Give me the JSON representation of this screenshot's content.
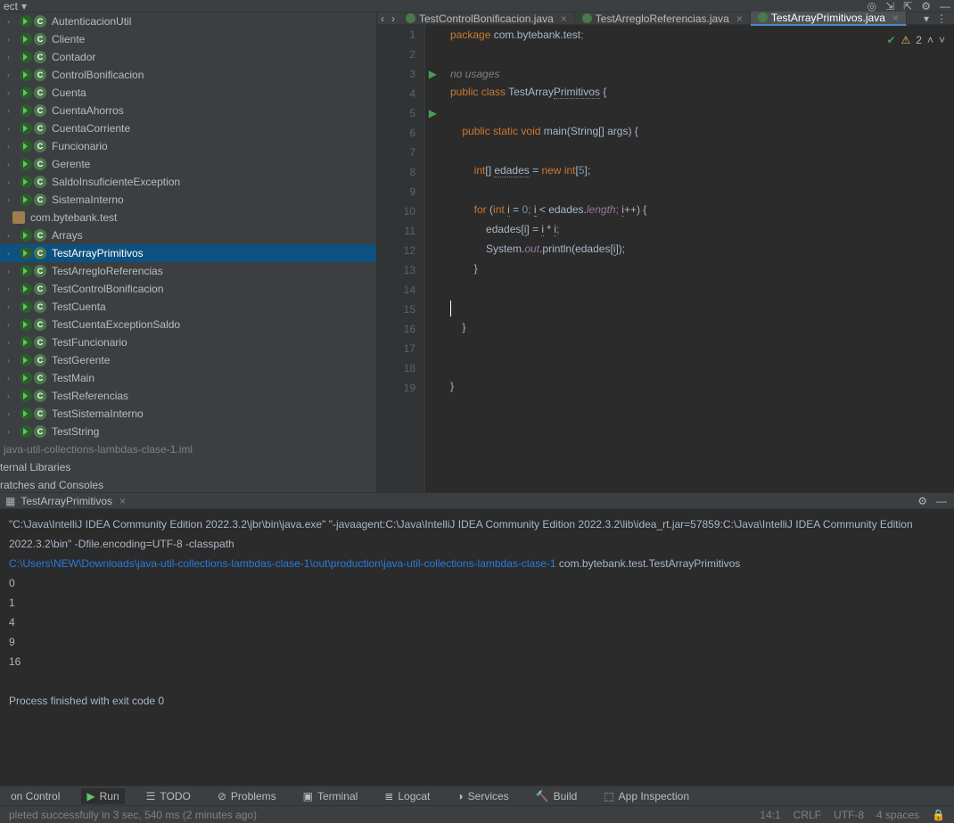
{
  "toolbar": {
    "project_label": "ect"
  },
  "tree": {
    "items": [
      {
        "chevron": true,
        "icons": [
          "run",
          "cls"
        ],
        "label": "AutenticacionUtil"
      },
      {
        "chevron": true,
        "icons": [
          "run",
          "cls"
        ],
        "label": "Cliente"
      },
      {
        "chevron": true,
        "icons": [
          "run",
          "cls"
        ],
        "label": "Contador"
      },
      {
        "chevron": true,
        "icons": [
          "run",
          "cls"
        ],
        "label": "ControlBonificacion"
      },
      {
        "chevron": true,
        "icons": [
          "run",
          "abs"
        ],
        "label": "Cuenta"
      },
      {
        "chevron": true,
        "icons": [
          "run",
          "cls"
        ],
        "label": "CuentaAhorros"
      },
      {
        "chevron": true,
        "icons": [
          "run",
          "cls"
        ],
        "label": "CuentaCorriente"
      },
      {
        "chevron": true,
        "icons": [
          "run",
          "abs"
        ],
        "label": "Funcionario"
      },
      {
        "chevron": true,
        "icons": [
          "run",
          "cls"
        ],
        "label": "Gerente"
      },
      {
        "chevron": true,
        "icons": [
          "run",
          "cls"
        ],
        "label": "SaldoInsuficienteException"
      },
      {
        "chevron": true,
        "icons": [
          "run",
          "cls"
        ],
        "label": "SistemaInterno"
      }
    ],
    "pkg_label": "com.bytebank.test",
    "tests": [
      {
        "label": "Arrays"
      },
      {
        "label": "TestArrayPrimitivos",
        "selected": true
      },
      {
        "label": "TestArregloReferencias"
      },
      {
        "label": "TestControlBonificacion"
      },
      {
        "label": "TestCuenta"
      },
      {
        "label": "TestCuentaExceptionSaldo"
      },
      {
        "label": "TestFuncionario"
      },
      {
        "label": "TestGerente"
      },
      {
        "label": "TestMain"
      },
      {
        "label": "TestReferencias"
      },
      {
        "label": "TestSistemaInterno"
      },
      {
        "label": "TestString"
      }
    ],
    "iml_label": "java-util-collections-lambdas-clase-1.iml",
    "ext_lib_label": "ternal Libraries",
    "scratch_label": "ratches and Consoles"
  },
  "tabs": {
    "t1": "TestControlBonificacion.java",
    "t2": "TestArregloReferencias.java",
    "t3": "TestArrayPrimitivos.java"
  },
  "editor": {
    "no_usages": "no usages",
    "inspections_count": "2",
    "lines": {
      "1": "1",
      "2": "2",
      "3": "3",
      "4": "4",
      "5": "5",
      "6": "6",
      "7": "7",
      "8": "8",
      "9": "9",
      "10": "10",
      "11": "11",
      "12": "12",
      "13": "13",
      "14": "14",
      "15": "15",
      "16": "16",
      "17": "17",
      "18": "18",
      "19": "19"
    },
    "code": {
      "kw_package": "package",
      "pkg_name": "com.bytebank.test",
      "kw_public": "public",
      "kw_class": "class",
      "cls_name": "TestArray",
      "cls_name2": "Primitivos",
      "kw_static": "static",
      "kw_void": "void",
      "main": "main",
      "params": "(String[] args) {",
      "kw_int": "int",
      "arr": "[]",
      "var_edades": "edades",
      "eq": "=",
      "kw_new": "new",
      "five": "5",
      "kw_for": "for",
      "zero": "0",
      "var_i": "i",
      "lt": "<",
      "len": "length",
      "sys": "System",
      "out": "out",
      "println": ".println(edades[",
      "close": "]);"
    }
  },
  "run": {
    "tab_label": "TestArrayPrimitivos",
    "cmd1": "\"C:\\Java\\IntelliJ IDEA Community Edition 2022.3.2\\jbr\\bin\\java.exe\" \"-javaagent:C:\\Java\\IntelliJ IDEA Community Edition 2022.3.2\\lib\\idea_rt.jar=57859:C:\\Java\\IntelliJ IDEA Community Edition 2022.3.2\\bin\" -Dfile.encoding=UTF-8 -classpath ",
    "link": "C:\\Users\\NEW\\Downloads\\java-util-collections-lambdas-clase-1\\out\\production\\java-util-collections-lambdas-clase-1",
    "cmd2": " com.bytebank.test.TestArrayPrimitivos",
    "out0": "0",
    "out1": "1",
    "out2": "4",
    "out3": "9",
    "out4": "16",
    "exit": "Process finished with exit code 0"
  },
  "bottom": {
    "vc": "on Control",
    "run": "Run",
    "todo": "TODO",
    "problems": "Problems",
    "terminal": "Terminal",
    "logcat": "Logcat",
    "services": "Services",
    "build": "Build",
    "appinsp": "App Inspection",
    "status_msg": "pleted successfully in 3 sec, 540 ms (2 minutes ago)"
  },
  "status": {
    "pos": "14:1",
    "crlf": "CRLF",
    "enc": "UTF-8",
    "indent": "4 spaces"
  }
}
